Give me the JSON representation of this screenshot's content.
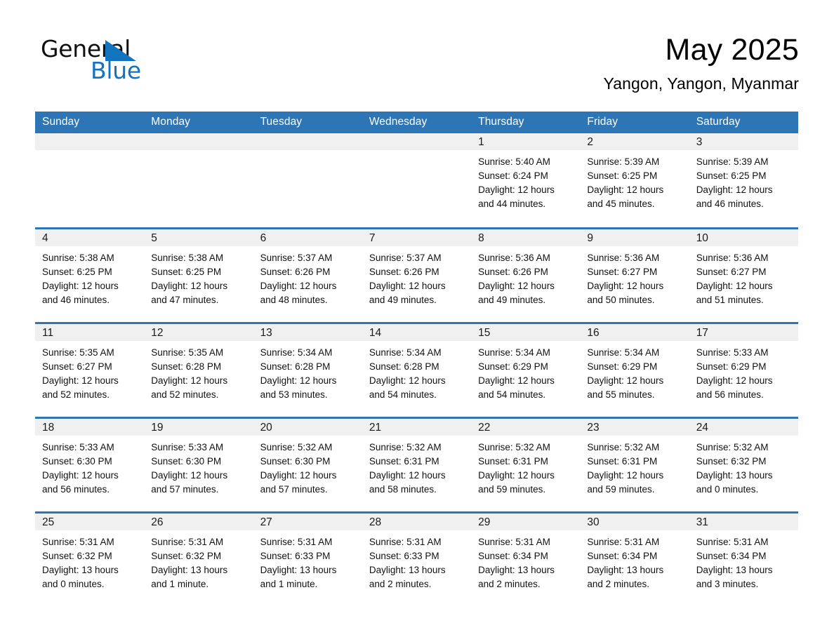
{
  "brand": {
    "name_part1": "General",
    "name_part2": "Blue",
    "triangle_icon": "blue-triangle-icon",
    "accent_color": "#1273be"
  },
  "header": {
    "title": "May 2025",
    "subtitle": "Yangon, Yangon, Myanmar"
  },
  "theme": {
    "header_blue": "#2e75b6",
    "daynum_band_gray": "#f0f0f0",
    "page_background": "#ffffff",
    "text_color": "#111111"
  },
  "weekday_headers": [
    "Sunday",
    "Monday",
    "Tuesday",
    "Wednesday",
    "Thursday",
    "Friday",
    "Saturday"
  ],
  "weeks": [
    [
      {
        "day": "",
        "sunrise": "",
        "sunset": "",
        "daylight_line1": "",
        "daylight_line2": ""
      },
      {
        "day": "",
        "sunrise": "",
        "sunset": "",
        "daylight_line1": "",
        "daylight_line2": ""
      },
      {
        "day": "",
        "sunrise": "",
        "sunset": "",
        "daylight_line1": "",
        "daylight_line2": ""
      },
      {
        "day": "",
        "sunrise": "",
        "sunset": "",
        "daylight_line1": "",
        "daylight_line2": ""
      },
      {
        "day": "1",
        "sunrise": "Sunrise: 5:40 AM",
        "sunset": "Sunset: 6:24 PM",
        "daylight_line1": "Daylight: 12 hours",
        "daylight_line2": "and 44 minutes."
      },
      {
        "day": "2",
        "sunrise": "Sunrise: 5:39 AM",
        "sunset": "Sunset: 6:25 PM",
        "daylight_line1": "Daylight: 12 hours",
        "daylight_line2": "and 45 minutes."
      },
      {
        "day": "3",
        "sunrise": "Sunrise: 5:39 AM",
        "sunset": "Sunset: 6:25 PM",
        "daylight_line1": "Daylight: 12 hours",
        "daylight_line2": "and 46 minutes."
      }
    ],
    [
      {
        "day": "4",
        "sunrise": "Sunrise: 5:38 AM",
        "sunset": "Sunset: 6:25 PM",
        "daylight_line1": "Daylight: 12 hours",
        "daylight_line2": "and 46 minutes."
      },
      {
        "day": "5",
        "sunrise": "Sunrise: 5:38 AM",
        "sunset": "Sunset: 6:25 PM",
        "daylight_line1": "Daylight: 12 hours",
        "daylight_line2": "and 47 minutes."
      },
      {
        "day": "6",
        "sunrise": "Sunrise: 5:37 AM",
        "sunset": "Sunset: 6:26 PM",
        "daylight_line1": "Daylight: 12 hours",
        "daylight_line2": "and 48 minutes."
      },
      {
        "day": "7",
        "sunrise": "Sunrise: 5:37 AM",
        "sunset": "Sunset: 6:26 PM",
        "daylight_line1": "Daylight: 12 hours",
        "daylight_line2": "and 49 minutes."
      },
      {
        "day": "8",
        "sunrise": "Sunrise: 5:36 AM",
        "sunset": "Sunset: 6:26 PM",
        "daylight_line1": "Daylight: 12 hours",
        "daylight_line2": "and 49 minutes."
      },
      {
        "day": "9",
        "sunrise": "Sunrise: 5:36 AM",
        "sunset": "Sunset: 6:27 PM",
        "daylight_line1": "Daylight: 12 hours",
        "daylight_line2": "and 50 minutes."
      },
      {
        "day": "10",
        "sunrise": "Sunrise: 5:36 AM",
        "sunset": "Sunset: 6:27 PM",
        "daylight_line1": "Daylight: 12 hours",
        "daylight_line2": "and 51 minutes."
      }
    ],
    [
      {
        "day": "11",
        "sunrise": "Sunrise: 5:35 AM",
        "sunset": "Sunset: 6:27 PM",
        "daylight_line1": "Daylight: 12 hours",
        "daylight_line2": "and 52 minutes."
      },
      {
        "day": "12",
        "sunrise": "Sunrise: 5:35 AM",
        "sunset": "Sunset: 6:28 PM",
        "daylight_line1": "Daylight: 12 hours",
        "daylight_line2": "and 52 minutes."
      },
      {
        "day": "13",
        "sunrise": "Sunrise: 5:34 AM",
        "sunset": "Sunset: 6:28 PM",
        "daylight_line1": "Daylight: 12 hours",
        "daylight_line2": "and 53 minutes."
      },
      {
        "day": "14",
        "sunrise": "Sunrise: 5:34 AM",
        "sunset": "Sunset: 6:28 PM",
        "daylight_line1": "Daylight: 12 hours",
        "daylight_line2": "and 54 minutes."
      },
      {
        "day": "15",
        "sunrise": "Sunrise: 5:34 AM",
        "sunset": "Sunset: 6:29 PM",
        "daylight_line1": "Daylight: 12 hours",
        "daylight_line2": "and 54 minutes."
      },
      {
        "day": "16",
        "sunrise": "Sunrise: 5:34 AM",
        "sunset": "Sunset: 6:29 PM",
        "daylight_line1": "Daylight: 12 hours",
        "daylight_line2": "and 55 minutes."
      },
      {
        "day": "17",
        "sunrise": "Sunrise: 5:33 AM",
        "sunset": "Sunset: 6:29 PM",
        "daylight_line1": "Daylight: 12 hours",
        "daylight_line2": "and 56 minutes."
      }
    ],
    [
      {
        "day": "18",
        "sunrise": "Sunrise: 5:33 AM",
        "sunset": "Sunset: 6:30 PM",
        "daylight_line1": "Daylight: 12 hours",
        "daylight_line2": "and 56 minutes."
      },
      {
        "day": "19",
        "sunrise": "Sunrise: 5:33 AM",
        "sunset": "Sunset: 6:30 PM",
        "daylight_line1": "Daylight: 12 hours",
        "daylight_line2": "and 57 minutes."
      },
      {
        "day": "20",
        "sunrise": "Sunrise: 5:32 AM",
        "sunset": "Sunset: 6:30 PM",
        "daylight_line1": "Daylight: 12 hours",
        "daylight_line2": "and 57 minutes."
      },
      {
        "day": "21",
        "sunrise": "Sunrise: 5:32 AM",
        "sunset": "Sunset: 6:31 PM",
        "daylight_line1": "Daylight: 12 hours",
        "daylight_line2": "and 58 minutes."
      },
      {
        "day": "22",
        "sunrise": "Sunrise: 5:32 AM",
        "sunset": "Sunset: 6:31 PM",
        "daylight_line1": "Daylight: 12 hours",
        "daylight_line2": "and 59 minutes."
      },
      {
        "day": "23",
        "sunrise": "Sunrise: 5:32 AM",
        "sunset": "Sunset: 6:31 PM",
        "daylight_line1": "Daylight: 12 hours",
        "daylight_line2": "and 59 minutes."
      },
      {
        "day": "24",
        "sunrise": "Sunrise: 5:32 AM",
        "sunset": "Sunset: 6:32 PM",
        "daylight_line1": "Daylight: 13 hours",
        "daylight_line2": "and 0 minutes."
      }
    ],
    [
      {
        "day": "25",
        "sunrise": "Sunrise: 5:31 AM",
        "sunset": "Sunset: 6:32 PM",
        "daylight_line1": "Daylight: 13 hours",
        "daylight_line2": "and 0 minutes."
      },
      {
        "day": "26",
        "sunrise": "Sunrise: 5:31 AM",
        "sunset": "Sunset: 6:32 PM",
        "daylight_line1": "Daylight: 13 hours",
        "daylight_line2": "and 1 minute."
      },
      {
        "day": "27",
        "sunrise": "Sunrise: 5:31 AM",
        "sunset": "Sunset: 6:33 PM",
        "daylight_line1": "Daylight: 13 hours",
        "daylight_line2": "and 1 minute."
      },
      {
        "day": "28",
        "sunrise": "Sunrise: 5:31 AM",
        "sunset": "Sunset: 6:33 PM",
        "daylight_line1": "Daylight: 13 hours",
        "daylight_line2": "and 2 minutes."
      },
      {
        "day": "29",
        "sunrise": "Sunrise: 5:31 AM",
        "sunset": "Sunset: 6:34 PM",
        "daylight_line1": "Daylight: 13 hours",
        "daylight_line2": "and 2 minutes."
      },
      {
        "day": "30",
        "sunrise": "Sunrise: 5:31 AM",
        "sunset": "Sunset: 6:34 PM",
        "daylight_line1": "Daylight: 13 hours",
        "daylight_line2": "and 2 minutes."
      },
      {
        "day": "31",
        "sunrise": "Sunrise: 5:31 AM",
        "sunset": "Sunset: 6:34 PM",
        "daylight_line1": "Daylight: 13 hours",
        "daylight_line2": "and 3 minutes."
      }
    ]
  ]
}
